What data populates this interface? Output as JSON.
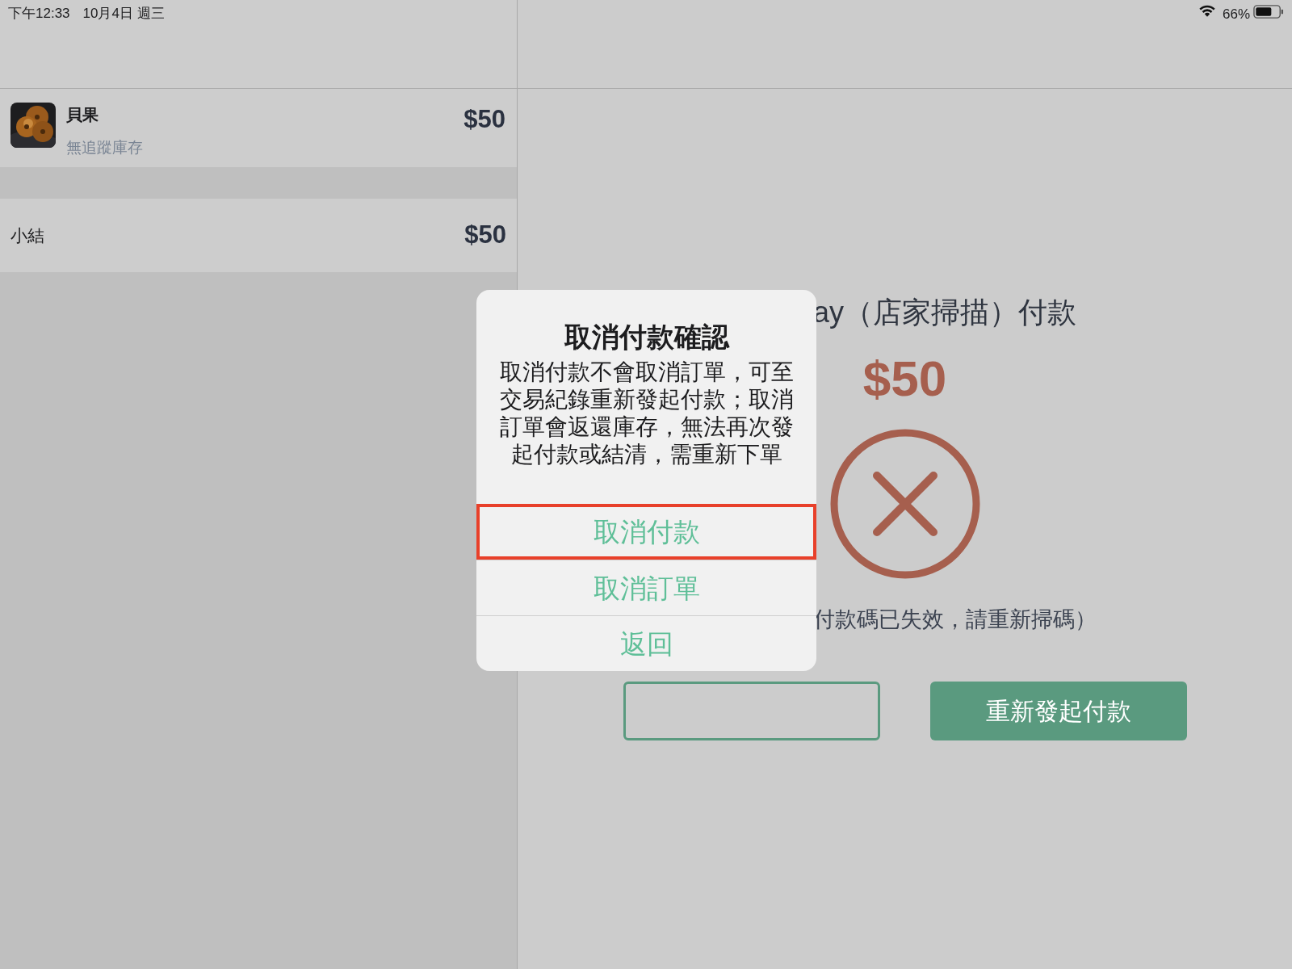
{
  "status_bar": {
    "time": "下午12:33",
    "date": "10月4日 週三",
    "battery": "66%"
  },
  "cart": {
    "items": [
      {
        "name": "貝果",
        "note": "無追蹤庫存",
        "price": "$50",
        "kind": "picture"
      }
    ],
    "subtotal": {
      "label": "小結",
      "value": "$50"
    }
  },
  "payment": {
    "title": "ay（店家掃描）付款",
    "amount": "$50",
    "status": "付款碼已失效，請重新掃碼）",
    "buttons": [
      {
        "kind": "outline"
      },
      {
        "kind": "filled",
        "label": "重新發起付款"
      }
    ]
  },
  "dialog": {
    "title": "取消付款確認",
    "message": "取消付款不會取消訂單，可至交易紀錄重新發起付款；取消訂單會返還庫存，無法再次發起付款或結清，需重新下單",
    "actions": [
      {
        "label": "取消付款",
        "highlighted": true
      },
      {
        "label": "取消訂單",
        "highlighted": false
      },
      {
        "label": "返回",
        "highlighted": false
      }
    ]
  }
}
